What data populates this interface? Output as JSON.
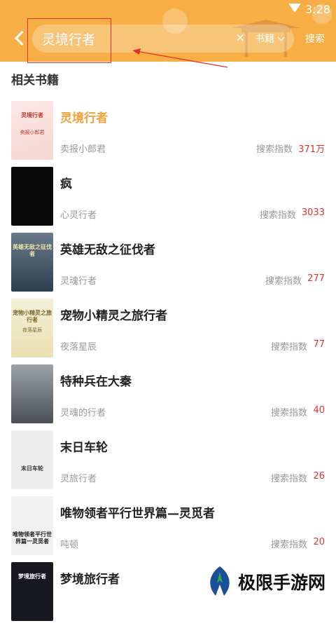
{
  "status": {
    "time": "3:28"
  },
  "header": {
    "query": "灵境行者",
    "clear_icon": "×",
    "scope_label": "书籍",
    "search_label": "搜索"
  },
  "section_title": "相关书籍",
  "books": [
    {
      "title": "灵境行者",
      "author": "卖报小郎君",
      "index_label": "搜索指数",
      "index_value": "371万",
      "cover_text": "灵境行者",
      "cover_sub": "卖报小郎君",
      "highlight": true
    },
    {
      "title": "疯",
      "author": "心灵行者",
      "index_label": "搜索指数",
      "index_value": "3033",
      "cover_text": "",
      "cover_sub": ""
    },
    {
      "title": "英雄无敌之征伐者",
      "author": "灵魂行者",
      "index_label": "搜索指数",
      "index_value": "277",
      "cover_text": "英雄无敌之征伐者",
      "cover_sub": ""
    },
    {
      "title": "宠物小精灵之旅行者",
      "author": "夜落星辰",
      "index_label": "搜索指数",
      "index_value": "77",
      "cover_text": "宠物小精灵之旅行者",
      "cover_sub": "夜落星辰"
    },
    {
      "title": "特种兵在大秦",
      "author": "灵魂的行者",
      "index_label": "搜索指数",
      "index_value": "40",
      "cover_text": "",
      "cover_sub": ""
    },
    {
      "title": "末日车轮",
      "author": "灵旅行者",
      "index_label": "搜索指数",
      "index_value": "26",
      "cover_text": "末日车轮",
      "cover_sub": ""
    },
    {
      "title": "唯物领者平行世界篇—灵觅者",
      "author": "吨顿",
      "index_label": "搜索指数",
      "index_value": "20",
      "cover_text": "唯物领者平行世界篇一灵觅者",
      "cover_sub": ""
    },
    {
      "title": "梦境旅行者",
      "author": "",
      "index_label": "",
      "index_value": "",
      "cover_text": "梦境旅行者",
      "cover_sub": ""
    }
  ],
  "watermark": {
    "text": "极限手游网"
  },
  "colors": {
    "header": "#f6ae45",
    "highlight": "#f6a03a",
    "index": "#e0322e",
    "annotation": "#e0322e"
  }
}
